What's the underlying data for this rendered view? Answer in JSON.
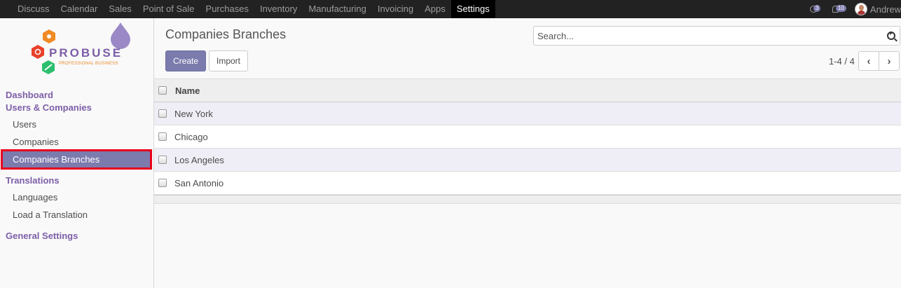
{
  "topnav": {
    "menus": [
      "Discuss",
      "Calendar",
      "Sales",
      "Point of Sale",
      "Purchases",
      "Inventory",
      "Manufacturing",
      "Invoicing",
      "Apps",
      "Settings"
    ],
    "active_menu": "Settings",
    "activity_count": "3",
    "messages_count": "10",
    "user_name": "Andrew"
  },
  "logo": {
    "name": "PROBUSE",
    "tagline": "PROFESSIONAL BUSINESS"
  },
  "sidebar": {
    "dashboard": "Dashboard",
    "users_companies": "Users & Companies",
    "users": "Users",
    "companies": "Companies",
    "companies_branches": "Companies Branches",
    "translations": "Translations",
    "languages": "Languages",
    "load_translation": "Load a Translation",
    "general_settings": "General Settings"
  },
  "control_panel": {
    "title": "Companies Branches",
    "create_label": "Create",
    "import_label": "Import",
    "search_placeholder": "Search...",
    "pager_value": "1-4 / 4"
  },
  "table": {
    "column_name": "Name",
    "rows": [
      "New York",
      "Chicago",
      "Los Angeles",
      "San Antonio"
    ]
  },
  "colors": {
    "accent": "#7c7bad",
    "highlight_border": "#e8001c",
    "topbar": "#222222"
  }
}
